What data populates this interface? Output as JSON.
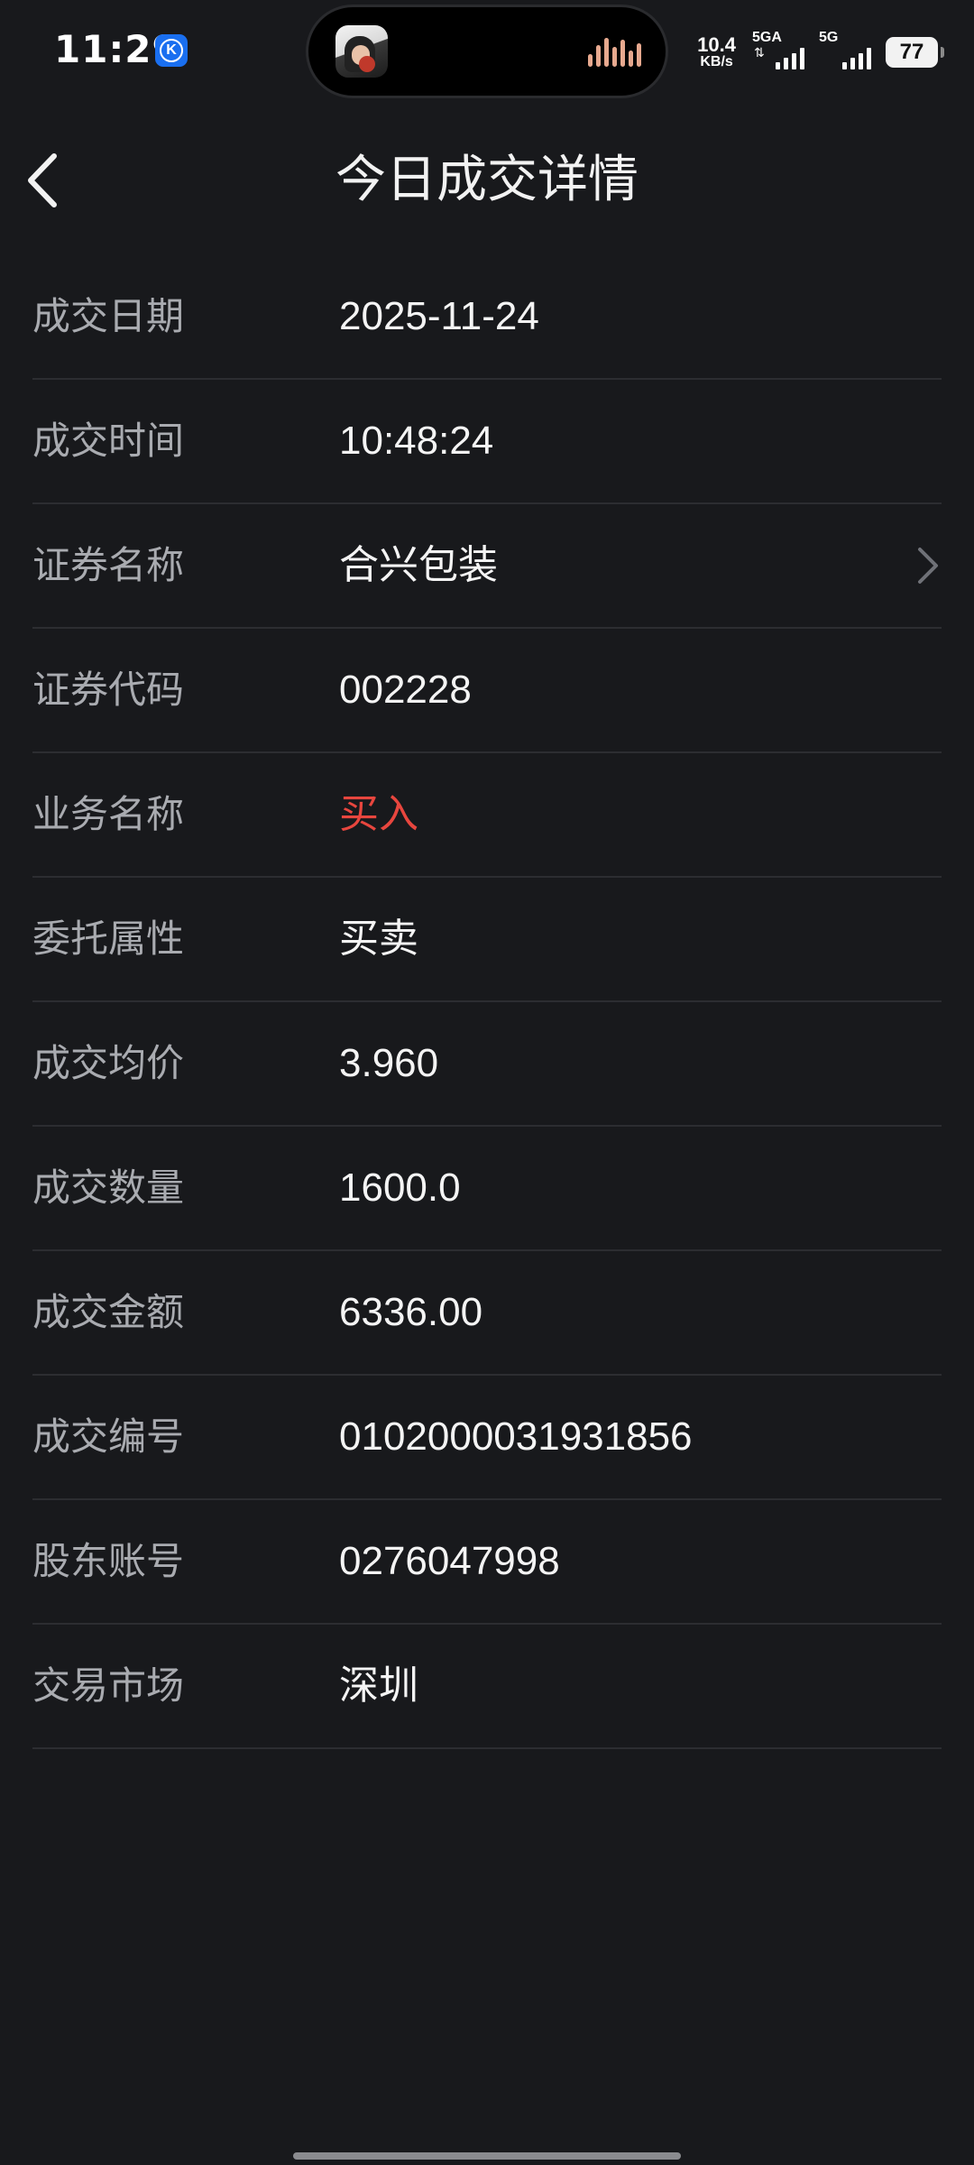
{
  "status_bar": {
    "time": "11:29",
    "net_speed_value": "10.4",
    "net_speed_unit": "KB/s",
    "sim1_label": "5GA",
    "sim2_label": "5G",
    "battery": "77",
    "k_badge": "K"
  },
  "header": {
    "title": "今日成交详情",
    "back_icon": "chevron-left-icon"
  },
  "details": [
    {
      "label": "成交日期",
      "value": "2025-11-24"
    },
    {
      "label": "成交时间",
      "value": "10:48:24"
    },
    {
      "label": "证券名称",
      "value": "合兴包装"
    },
    {
      "label": "证券代码",
      "value": "002228"
    },
    {
      "label": "业务名称",
      "value": "买入"
    },
    {
      "label": "委托属性",
      "value": "买卖"
    },
    {
      "label": "成交均价",
      "value": "3.960"
    },
    {
      "label": "成交数量",
      "value": "1600.0"
    },
    {
      "label": "成交金额",
      "value": "6336.00"
    },
    {
      "label": "成交编号",
      "value": "0102000031931856"
    },
    {
      "label": "股东账号",
      "value": "0276047998"
    },
    {
      "label": "交易市场",
      "value": "深圳"
    }
  ],
  "colors": {
    "background": "#18191c",
    "label": "#a9abb0",
    "value": "#f4f4f4",
    "buy_red": "#e8463e",
    "divider": "#2c2d31"
  }
}
